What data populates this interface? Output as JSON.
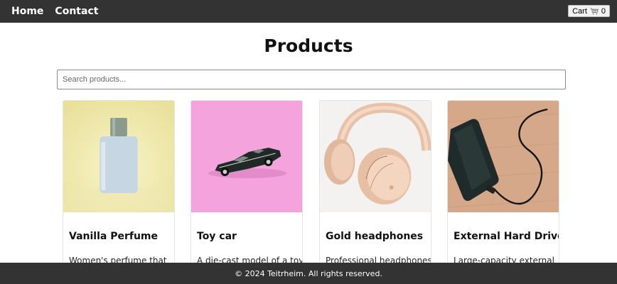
{
  "nav": {
    "links": [
      "Home",
      "Contact"
    ],
    "cart_label": "Cart",
    "cart_icon": "cart-icon",
    "cart_count": "0"
  },
  "page": {
    "title": "Products",
    "search_placeholder": "Search products..."
  },
  "products": [
    {
      "name": "Vanilla Perfume",
      "description": "Women's perfume that",
      "image": "perfume-bottle-image"
    },
    {
      "name": "Toy car",
      "description": "A die-cast model of a toy",
      "image": "toy-car-image"
    },
    {
      "name": "Gold headphones",
      "description": "Professional headphones",
      "image": "headphones-image"
    },
    {
      "name": "External Hard Drive",
      "description": "Large-capacity external",
      "image": "hard-drive-image"
    }
  ],
  "footer": {
    "text": "© 2024 Teitrheim. All rights reserved."
  },
  "colors": {
    "topbar": "#333333",
    "footer": "#333333"
  }
}
